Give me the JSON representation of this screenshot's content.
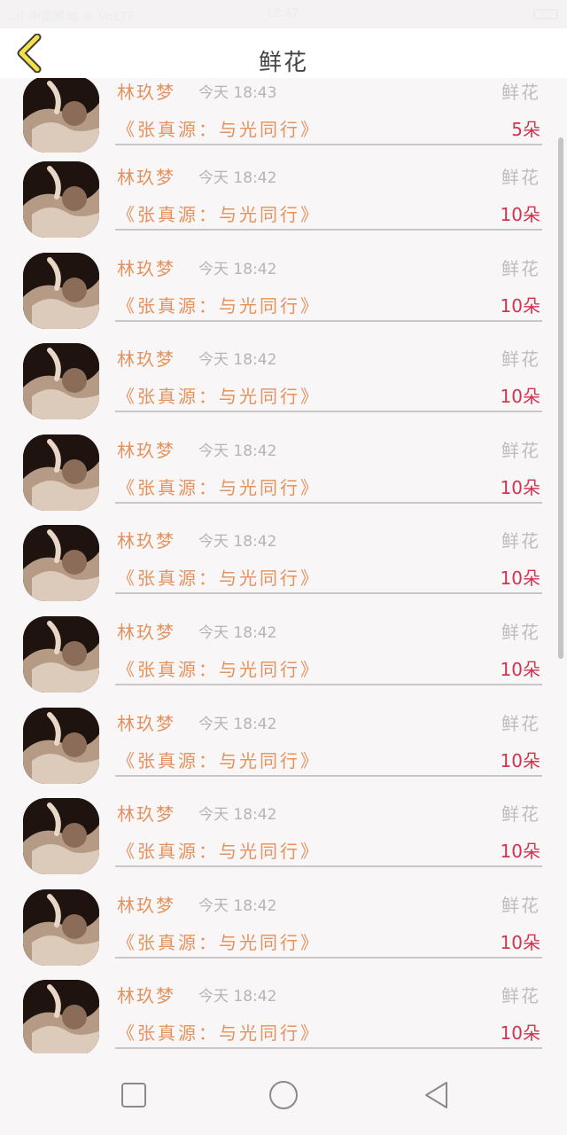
{
  "status_bar": {
    "left_text": "..ıl 中国移动 ≋ VoLTE",
    "time": "18:47"
  },
  "header": {
    "title": "鲜花"
  },
  "colors": {
    "accent": "#e4925d",
    "count_red": "#d2334f",
    "back_yellow": "#f6e04a"
  },
  "icons": {
    "back": "chevron-left-icon",
    "home": "circle-icon",
    "recents": "square-icon",
    "nav_back": "triangle-back-icon"
  },
  "rows": [
    {
      "name": "林玖梦",
      "time": "今天 18:43",
      "gift": "鲜花",
      "song": "《张真源：与光同行》",
      "count": "5朵"
    },
    {
      "name": "林玖梦",
      "time": "今天 18:42",
      "gift": "鲜花",
      "song": "《张真源：与光同行》",
      "count": "10朵"
    },
    {
      "name": "林玖梦",
      "time": "今天 18:42",
      "gift": "鲜花",
      "song": "《张真源：与光同行》",
      "count": "10朵"
    },
    {
      "name": "林玖梦",
      "time": "今天 18:42",
      "gift": "鲜花",
      "song": "《张真源：与光同行》",
      "count": "10朵"
    },
    {
      "name": "林玖梦",
      "time": "今天 18:42",
      "gift": "鲜花",
      "song": "《张真源：与光同行》",
      "count": "10朵"
    },
    {
      "name": "林玖梦",
      "time": "今天 18:42",
      "gift": "鲜花",
      "song": "《张真源：与光同行》",
      "count": "10朵"
    },
    {
      "name": "林玖梦",
      "time": "今天 18:42",
      "gift": "鲜花",
      "song": "《张真源：与光同行》",
      "count": "10朵"
    },
    {
      "name": "林玖梦",
      "time": "今天 18:42",
      "gift": "鲜花",
      "song": "《张真源：与光同行》",
      "count": "10朵"
    },
    {
      "name": "林玖梦",
      "time": "今天 18:42",
      "gift": "鲜花",
      "song": "《张真源：与光同行》",
      "count": "10朵"
    },
    {
      "name": "林玖梦",
      "time": "今天 18:42",
      "gift": "鲜花",
      "song": "《张真源：与光同行》",
      "count": "10朵"
    },
    {
      "name": "林玖梦",
      "time": "今天 18:42",
      "gift": "鲜花",
      "song": "《张真源：与光同行》",
      "count": "10朵"
    }
  ]
}
